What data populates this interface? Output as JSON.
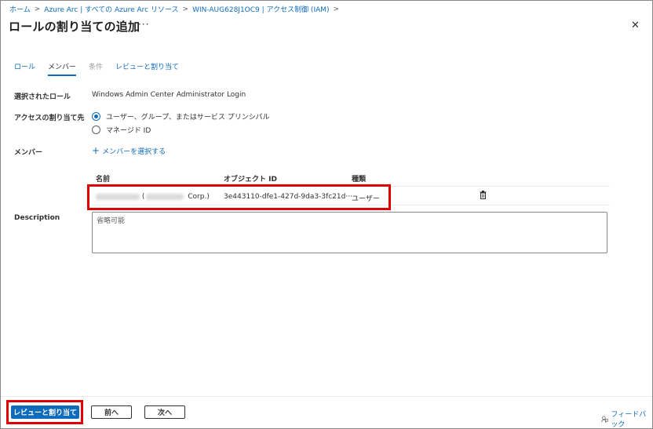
{
  "breadcrumb": [
    "ホーム",
    "Azure Arc | すべての Azure Arc リソース",
    "WIN-AUG628J1OC9 | アクセス制御 (IAM)"
  ],
  "page": {
    "title": "ロールの割り当ての追加",
    "more": "···",
    "close": "✕"
  },
  "tabs": [
    {
      "label": "ロール",
      "state": "link"
    },
    {
      "label": "メンバー",
      "state": "active"
    },
    {
      "label": "条件",
      "state": "disabled"
    },
    {
      "label": "レビューと割り当て",
      "state": "link"
    }
  ],
  "form": {
    "role_label": "選択されたロール",
    "role_value": "Windows Admin Center Administrator Login",
    "assign_label": "アクセスの割り当て先",
    "assign_options": [
      {
        "label": "ユーザー、グループ、またはサービス プリンシパル",
        "checked": true
      },
      {
        "label": "マネージド ID",
        "checked": false
      }
    ],
    "members_label": "メンバー",
    "select_members": "メンバーを選択する",
    "description_label": "Description",
    "description_placeholder": "省略可能"
  },
  "members_table": {
    "columns": [
      "名前",
      "オブジェクト ID",
      "種類"
    ],
    "rows": [
      {
        "name_paren_open": "(",
        "name_suffix": "Corp.)",
        "object_id": "3e443110-dfe1-427d-9da3-3fc21d···",
        "type": "ユーザー"
      }
    ]
  },
  "footer": {
    "review_button": "レビューと割り当て",
    "prev_button": "前へ",
    "next_button": "次へ",
    "feedback": "フィードバック"
  },
  "colors": {
    "accent": "#0f6cbd",
    "highlight": "#e00000"
  }
}
